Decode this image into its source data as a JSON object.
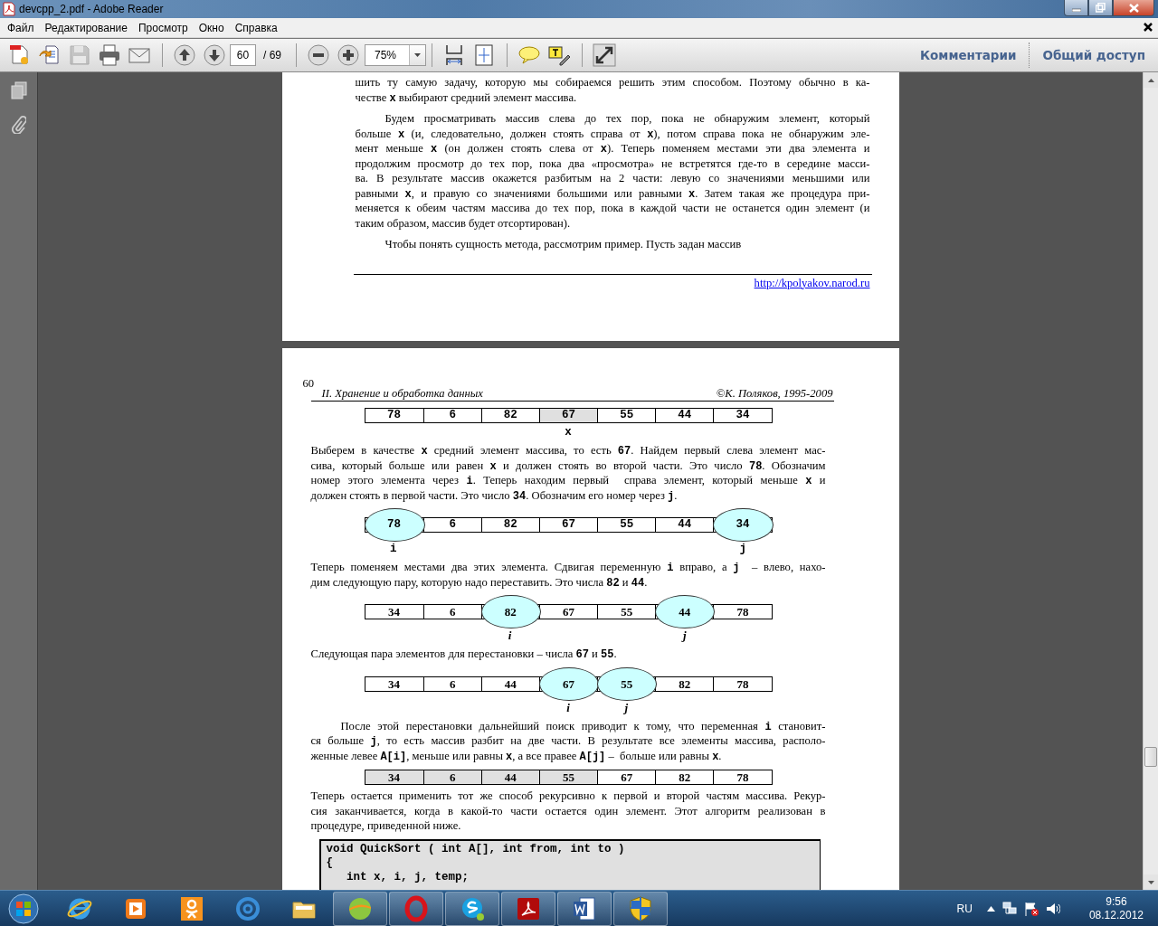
{
  "window": {
    "title": "devcpp_2.pdf - Adobe Reader"
  },
  "menu": [
    {
      "label": "Файл"
    },
    {
      "label": "Редактирование"
    },
    {
      "label": "Просмотр"
    },
    {
      "label": "Окно"
    },
    {
      "label": "Справка"
    }
  ],
  "toolbar": {
    "file_tools": [
      {
        "kind": "create",
        "disabled": false
      },
      {
        "kind": "export",
        "disabled": false
      },
      {
        "kind": "save",
        "disabled": true
      },
      {
        "kind": "print",
        "disabled": false
      },
      {
        "kind": "email",
        "disabled": false
      }
    ],
    "nav_tools": [
      {
        "kind": "prev",
        "disabled": false
      },
      {
        "kind": "next",
        "disabled": false
      }
    ],
    "page": {
      "value": "60",
      "total": "/ 69"
    },
    "zoom_tools": [
      {
        "kind": "zoom_out",
        "disabled": false
      },
      {
        "kind": "zoom_in",
        "disabled": false
      }
    ],
    "zoom": {
      "value": "75%"
    },
    "view_tools": [
      {
        "kind": "fit_width",
        "disabled": false
      },
      {
        "kind": "fit_page",
        "disabled": false
      }
    ],
    "comment_tools": [
      {
        "kind": "comment",
        "disabled": false
      },
      {
        "kind": "highlight",
        "disabled": false
      }
    ],
    "screen_tools": [
      {
        "kind": "fullscreen",
        "disabled": false
      }
    ],
    "panes": [
      {
        "label": "Комментарии"
      },
      {
        "label": "Общий доступ"
      }
    ]
  },
  "pages": [
    {
      "blocks": [
        {
          "kind": "para",
          "indent": false,
          "text": "шить ту самую задачу, которую мы собираемся решить этим способом. Поэтому обычно в ка-\nчестве **x** выбирают средний элемент массива."
        },
        {
          "kind": "para",
          "indent": true,
          "text": "Будем просматривать массив слева до тех пор, пока не обнаружим элемент, который\nбольше **x** (и, следовательно, должен стоять справа от **x**), потом справа пока не обнаружим эле-\nмент меньше **x** (он должен стоять слева от **x**). Теперь поменяем местами эти два элемента и\nпродолжим просмотр до тех пор, пока два «просмотра» не встретятся где-то в середине масси-\nва. В результате массив окажется разбитым на 2 части: левую со значениями меньшими или\nравными **x**, и правую со значениями большими или равными **x**. Затем такая же процедура при-\nменяется к обеим частям массива до тех пор, пока в каждой части не останется один элемент (и\nтаким образом, массив будет отсортирован)."
        },
        {
          "kind": "para",
          "indent": true,
          "text": "Чтобы понять сущность метода, рассмотрим пример. Пусть задан массив"
        }
      ],
      "footer_link": "http://kpolyakov.narod.ru"
    },
    {
      "number": "60",
      "header_left": "II. Хранение и обработка данных",
      "header_right": "©К. Поляков, 1995-2009",
      "blocks": [
        {
          "kind": "array_mono",
          "cells": [
            {
              "value": "78",
              "shaded": false,
              "circled": false
            },
            {
              "value": "6",
              "shaded": false,
              "circled": false
            },
            {
              "value": "82",
              "shaded": false,
              "circled": false
            },
            {
              "value": "67",
              "shaded": true,
              "circled": false,
              "label": "x"
            },
            {
              "value": "55",
              "shaded": false,
              "circled": false
            },
            {
              "value": "44",
              "shaded": false,
              "circled": false
            },
            {
              "value": "34",
              "shaded": false,
              "circled": false
            }
          ]
        },
        {
          "kind": "para",
          "indent": false,
          "text": "Выберем в качестве **x** средний элемент массива, то есть **67**. Найдем первый слева элемент мас-\nсива, который больше или равен **x** и должен стоять во второй части. Это число **78**. Обозначим\nномер этого элемента через **i**. Теперь находим первый  справа элемент, который меньше **x** и\nдолжен стоять в первой части. Это число **34**. Обозначим его номер через **j**."
        },
        {
          "kind": "array_mono",
          "cells": [
            {
              "value": "78",
              "shaded": false,
              "circled": true,
              "label": "i"
            },
            {
              "value": "6",
              "shaded": false,
              "circled": false
            },
            {
              "value": "82",
              "shaded": false,
              "circled": false
            },
            {
              "value": "67",
              "shaded": false,
              "circled": false
            },
            {
              "value": "55",
              "shaded": false,
              "circled": false
            },
            {
              "value": "44",
              "shaded": false,
              "circled": false
            },
            {
              "value": "34",
              "shaded": false,
              "circled": true,
              "label": "j"
            }
          ]
        },
        {
          "kind": "para",
          "indent": false,
          "text": "Теперь поменяем местами два этих элемента. Сдвигая переменную **i** вправо, а **j**  – влево, нахо-\nдим следующую пару, которую надо переставить. Это числа **82** и **44**."
        },
        {
          "kind": "array_serif",
          "cells": [
            {
              "value": "34",
              "shaded": false,
              "circled": false
            },
            {
              "value": "6",
              "shaded": false,
              "circled": false
            },
            {
              "value": "82",
              "shaded": false,
              "circled": true,
              "label": "i"
            },
            {
              "value": "67",
              "shaded": false,
              "circled": false
            },
            {
              "value": "55",
              "shaded": false,
              "circled": false
            },
            {
              "value": "44",
              "shaded": false,
              "circled": true,
              "label": "j"
            },
            {
              "value": "78",
              "shaded": false,
              "circled": false
            }
          ]
        },
        {
          "kind": "para",
          "indent": false,
          "text": "Следующая пара элементов для перестановки – числа **67** и **55**."
        },
        {
          "kind": "array_serif",
          "cells": [
            {
              "value": "34",
              "shaded": false,
              "circled": false
            },
            {
              "value": "6",
              "shaded": false,
              "circled": false
            },
            {
              "value": "44",
              "shaded": false,
              "circled": false
            },
            {
              "value": "67",
              "shaded": false,
              "circled": true,
              "label": "i"
            },
            {
              "value": "55",
              "shaded": false,
              "circled": true,
              "label": "j"
            },
            {
              "value": "82",
              "shaded": false,
              "circled": false
            },
            {
              "value": "78",
              "shaded": false,
              "circled": false
            }
          ]
        },
        {
          "kind": "para",
          "indent": true,
          "text": "После этой перестановки дальнейший поиск приводит к тому, что переменная **i** становит-\nся больше **j**, то есть массив разбит на две части. В результате все элементы массива, располо-\nженные левее **A[i]**, меньше или равны **x**, а все правее **A[j]** –  больше или равны **x**."
        },
        {
          "kind": "array_serif",
          "cells": [
            {
              "value": "34",
              "shaded": true,
              "circled": false
            },
            {
              "value": "6",
              "shaded": true,
              "circled": false
            },
            {
              "value": "44",
              "shaded": true,
              "circled": false
            },
            {
              "value": "55",
              "shaded": true,
              "circled": false
            },
            {
              "value": "67",
              "shaded": false,
              "circled": false
            },
            {
              "value": "82",
              "shaded": false,
              "circled": false
            },
            {
              "value": "78",
              "shaded": false,
              "circled": false
            }
          ]
        },
        {
          "kind": "para",
          "indent": false,
          "text": "Теперь остается применить тот же способ рекурсивно к первой и второй частям массива. Рекур-\nсия заканчивается, когда в какой-то части остается один элемент. Этот алгоритм реализован в\nпроцедуре, приведенной ниже."
        },
        {
          "kind": "code",
          "lines": [
            "void QuickSort ( int A[], int from, int to )",
            "{",
            "   int x, i, j, temp;"
          ]
        }
      ]
    }
  ],
  "taskbar": {
    "items": [
      {
        "kind": "browser",
        "open": false
      },
      {
        "kind": "media",
        "open": false
      },
      {
        "kind": "social",
        "open": false
      },
      {
        "kind": "mail",
        "open": false
      },
      {
        "kind": "folder",
        "open": false
      },
      {
        "kind": "ball",
        "open": true
      },
      {
        "kind": "opera",
        "open": true
      },
      {
        "kind": "chat",
        "open": true
      },
      {
        "kind": "acrobat",
        "open": true
      },
      {
        "kind": "word",
        "open": true
      },
      {
        "kind": "shield",
        "open": true
      }
    ],
    "language": "RU",
    "time": "9:56",
    "date": "08.12.2012"
  }
}
